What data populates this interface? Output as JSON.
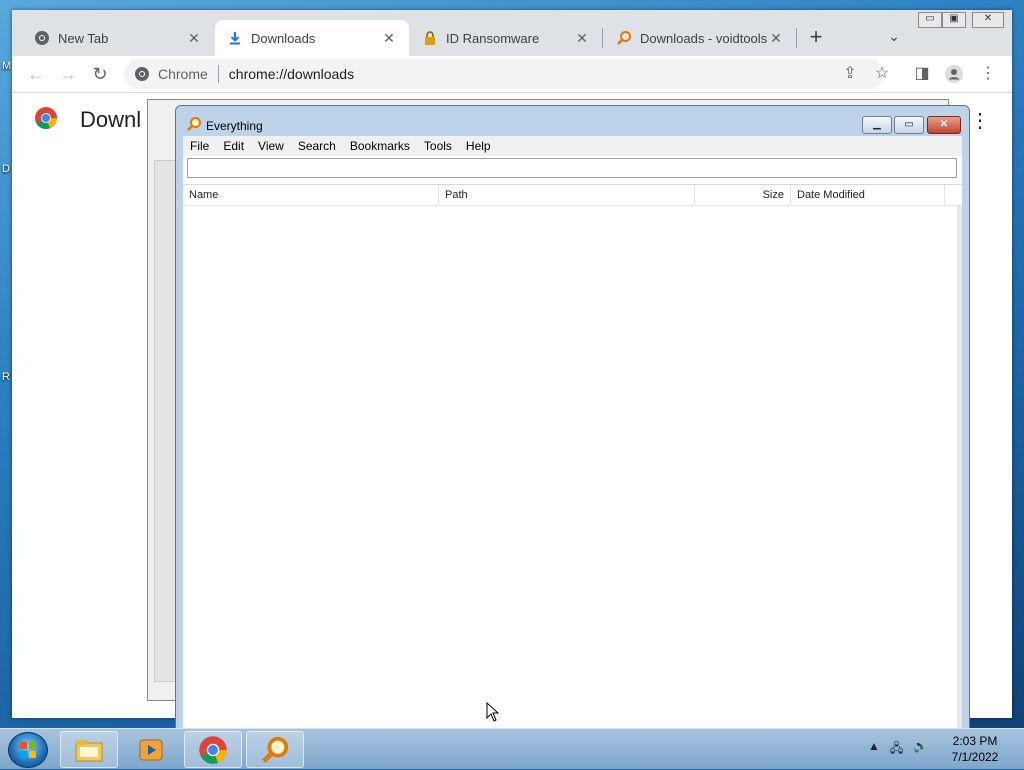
{
  "desktop": {
    "labels": [
      "M",
      "D",
      "R"
    ]
  },
  "chrome": {
    "tabs": [
      {
        "label": "New Tab",
        "icon": "chrome-icon",
        "active": false
      },
      {
        "label": "Downloads",
        "icon": "download-icon",
        "active": true
      },
      {
        "label": "ID Ransomware",
        "icon": "lock-icon",
        "active": false
      },
      {
        "label": "Downloads - voidtools",
        "icon": "magnifier-icon",
        "active": false
      }
    ],
    "new_tab": "+",
    "tab_close": "✕",
    "omnibox": {
      "site": "Chrome",
      "url": "chrome://downloads"
    },
    "page_title": "Downloads",
    "page_title_visible": "Downl"
  },
  "everything": {
    "title": "Everything",
    "menu": [
      "File",
      "Edit",
      "View",
      "Search",
      "Bookmarks",
      "Tools",
      "Help"
    ],
    "search_value": "",
    "columns": [
      "Name",
      "Path",
      "Size",
      "Date Modified"
    ],
    "rows": []
  },
  "taskbar": {
    "apps": [
      "file-explorer-icon",
      "media-player-icon",
      "chrome-icon",
      "everything-icon"
    ],
    "clock": {
      "time": "2:03 PM",
      "date": "7/1/2022"
    }
  }
}
